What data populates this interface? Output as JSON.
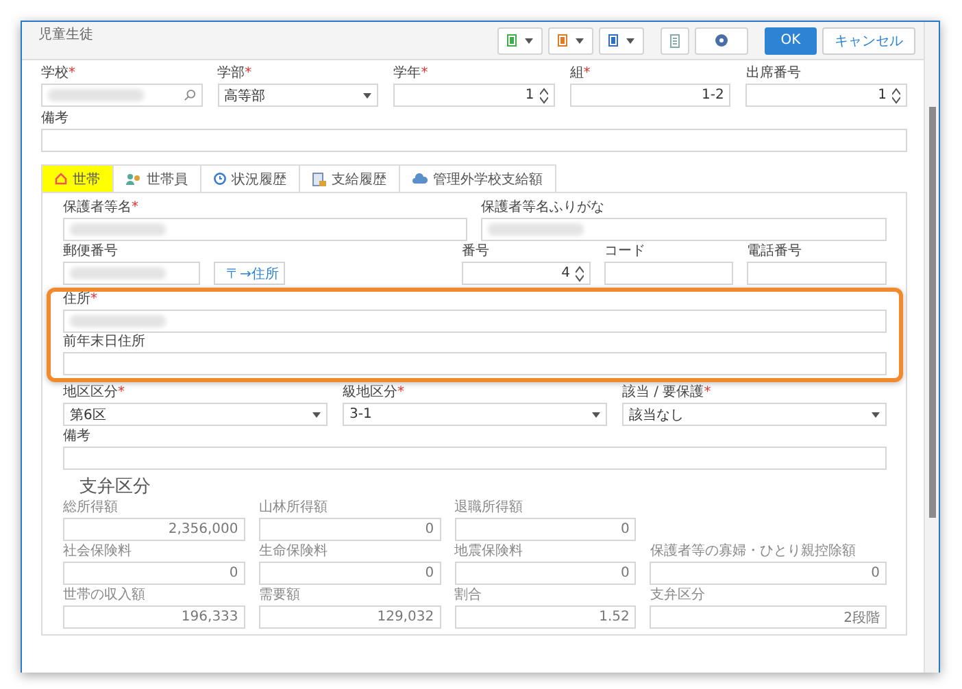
{
  "window": {
    "title": "児童生徒"
  },
  "toolbar": [
    {
      "kind": "dropdown",
      "color": "#3fae49"
    },
    {
      "kind": "dropdown",
      "color": "#e07b24"
    },
    {
      "kind": "dropdown",
      "color": "#2e6fc0"
    },
    {
      "kind": "calculator"
    },
    {
      "kind": "help"
    }
  ],
  "buttons": [
    {
      "label": "OK",
      "primary": true
    },
    {
      "label": "キャンセル",
      "primary": false
    }
  ],
  "student_fields": [
    {
      "label": "学校",
      "mark": "*",
      "kind": "search",
      "redacted": true
    },
    {
      "label": "学部",
      "mark": "*",
      "kind": "select",
      "value": "高等部"
    },
    {
      "label": "学年",
      "mark": "*",
      "kind": "spin",
      "value": "1"
    },
    {
      "label": "組",
      "mark": "*",
      "kind": "number",
      "value": "1-2"
    },
    {
      "label": "出席番号",
      "kind": "spin",
      "value": "1"
    }
  ],
  "student_note": {
    "label": "備考",
    "kind": "text"
  },
  "tabs": [
    {
      "label": "世帯",
      "selected": true
    },
    {
      "label": "世帯員",
      "selected": false
    },
    {
      "label": "状況履歴",
      "selected": false
    },
    {
      "label": "支給履歴",
      "selected": false
    },
    {
      "label": "管理外学校支給額",
      "selected": false
    }
  ],
  "guardian": [
    {
      "label": "保護者等名",
      "mark": "*",
      "kind": "text",
      "redacted": true
    },
    {
      "label": "保護者等名ふりがな",
      "kind": "text",
      "redacted": true
    }
  ],
  "postal": {
    "field": {
      "label": "郵便番号",
      "kind": "text",
      "redacted": true
    },
    "button": "〒→住所",
    "others": [
      {
        "label": "番号",
        "kind": "spin",
        "value": "4"
      },
      {
        "label": "コード",
        "kind": "text"
      },
      {
        "label": "電話番号",
        "kind": "text"
      }
    ]
  },
  "address": [
    {
      "label": "住所",
      "mark": "*",
      "kind": "text",
      "redacted": true
    },
    {
      "label": "前年末日住所",
      "kind": "text"
    }
  ],
  "district": [
    {
      "label": "地区区分",
      "mark": "*",
      "kind": "select",
      "value": "第6区"
    },
    {
      "label": "級地区分",
      "mark": "*",
      "kind": "select",
      "value": "3-1"
    },
    {
      "label": "該当 / 要保護",
      "mark": "*",
      "kind": "select",
      "value": "該当なし"
    }
  ],
  "household_note": {
    "label": "備考",
    "kind": "text"
  },
  "support": {
    "heading": "支弁区分",
    "rows": [
      [
        {
          "label": "総所得額",
          "kind": "number",
          "value": "2,356,000"
        },
        {
          "label": "山林所得額",
          "kind": "number",
          "value": "0"
        },
        {
          "label": "退職所得額",
          "kind": "number",
          "value": "0"
        }
      ],
      [
        {
          "label": "社会保険料",
          "kind": "number",
          "value": "0"
        },
        {
          "label": "生命保険料",
          "kind": "number",
          "value": "0"
        },
        {
          "label": "地震保険料",
          "kind": "number",
          "value": "0"
        },
        {
          "label": "保護者等の寡婦・ひとり親控除額",
          "kind": "number",
          "value": "0"
        }
      ],
      [
        {
          "label": "世帯の収入額",
          "kind": "number",
          "value": "196,333"
        },
        {
          "label": "需要額",
          "kind": "number",
          "value": "129,032"
        },
        {
          "label": "割合",
          "kind": "number",
          "value": "1.52"
        },
        {
          "label": "支弁区分",
          "kind": "number",
          "value": "2段階"
        }
      ]
    ]
  }
}
